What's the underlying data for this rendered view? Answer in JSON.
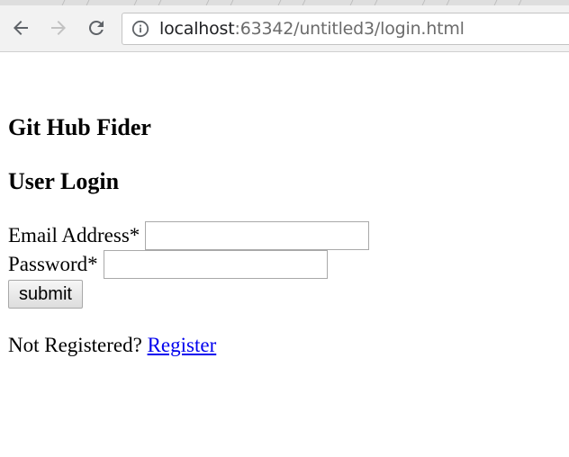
{
  "browser": {
    "url_host": "localhost",
    "url_rest": ":63342/untitled3/login.html",
    "icons": {
      "back": "arrow-left-icon",
      "forward": "arrow-right-icon",
      "reload": "reload-icon",
      "site_info": "info-icon"
    }
  },
  "page": {
    "site_title": "Git Hub Fider",
    "login_heading": "User Login",
    "form": {
      "email_label": "Email Address*",
      "email_value": "",
      "password_label": "Password*",
      "password_value": "",
      "submit_label": "submit"
    },
    "register": {
      "prompt": "Not Registered?",
      "link_text": "Register"
    }
  },
  "colors": {
    "link": "#0000ee",
    "toolbar_bg": "#f2f2f2",
    "url_host": "#202124",
    "url_rest": "#6b6b6b"
  }
}
